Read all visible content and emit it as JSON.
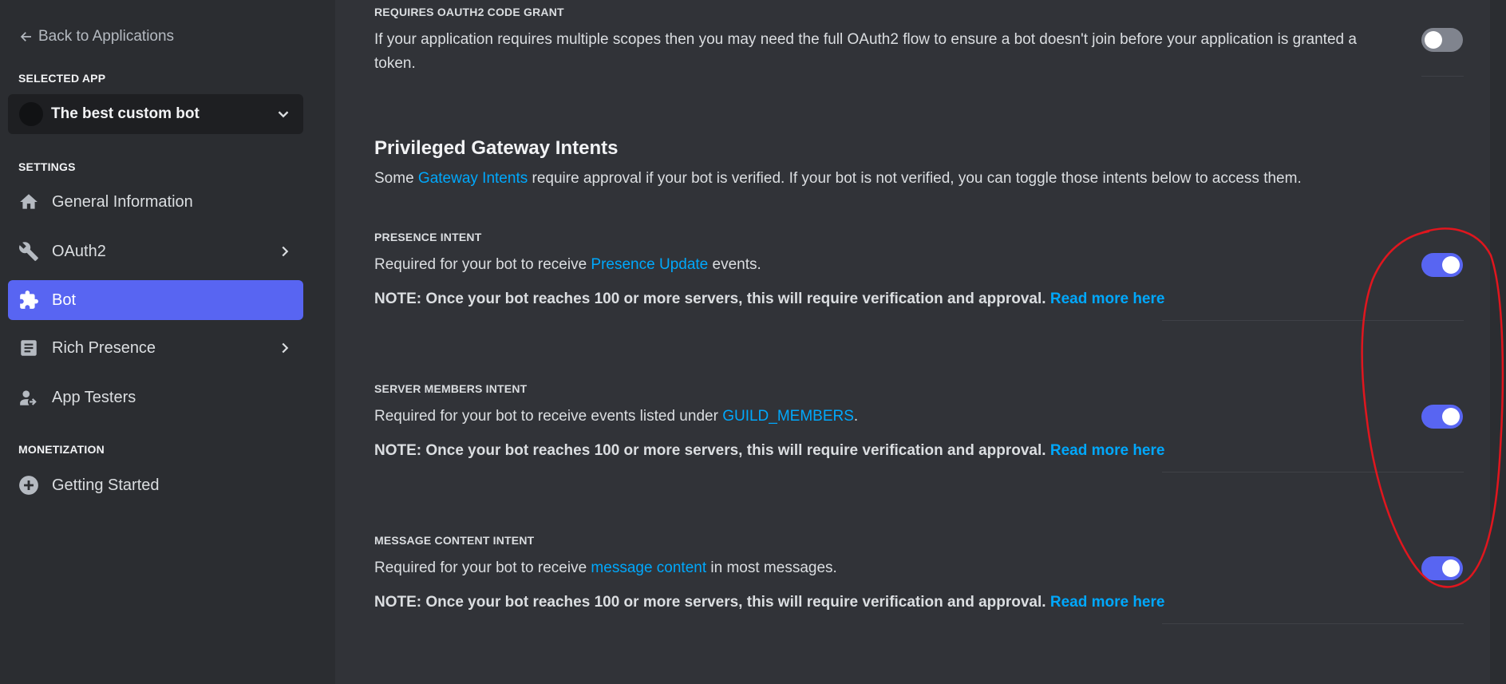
{
  "sidebar": {
    "back_label": "Back to Applications",
    "selected_app_label": "SELECTED APP",
    "app_name": "The best custom bot",
    "settings_label": "SETTINGS",
    "items": [
      {
        "label": "General Information",
        "icon": "home-icon"
      },
      {
        "label": "OAuth2",
        "icon": "wrench-icon"
      },
      {
        "label": "Bot",
        "icon": "puzzle-icon"
      },
      {
        "label": "Rich Presence",
        "icon": "document-icon"
      },
      {
        "label": "App Testers",
        "icon": "person-icon"
      }
    ],
    "monetization_label": "MONETIZATION",
    "monetization_items": [
      {
        "label": "Getting Started",
        "icon": "plus-circle-icon"
      }
    ]
  },
  "oauth_grant": {
    "title": "REQUIRES OAUTH2 CODE GRANT",
    "desc_line1": "If your application requires multiple scopes then you may need the full OAuth2 flow to ensure a bot doesn't join before your application is granted a",
    "desc_line2": "token.",
    "enabled": false
  },
  "intents": {
    "heading": "Privileged Gateway Intents",
    "desc_before": "Some ",
    "desc_link": "Gateway Intents",
    "desc_after": " require approval if your bot is verified. If your bot is not verified, you can toggle those intents below to access them.",
    "note_text": "NOTE: Once your bot reaches 100 or more servers, this will require verification and approval.",
    "note_link": "Read more here",
    "items": [
      {
        "title": "PRESENCE INTENT",
        "desc_before": "Required for your bot to receive ",
        "desc_link": "Presence Update",
        "desc_after": " events.",
        "enabled": true
      },
      {
        "title": "SERVER MEMBERS INTENT",
        "desc_before": "Required for your bot to receive events listed under ",
        "desc_link": "GUILD_MEMBERS",
        "desc_after": ".",
        "enabled": true
      },
      {
        "title": "MESSAGE CONTENT INTENT",
        "desc_before": "Required for your bot to receive ",
        "desc_link": "message content",
        "desc_after": " in most messages.",
        "enabled": true
      }
    ]
  },
  "colors": {
    "accent": "#5865f2",
    "link": "#00a8fc",
    "annotation": "#e0161e"
  }
}
